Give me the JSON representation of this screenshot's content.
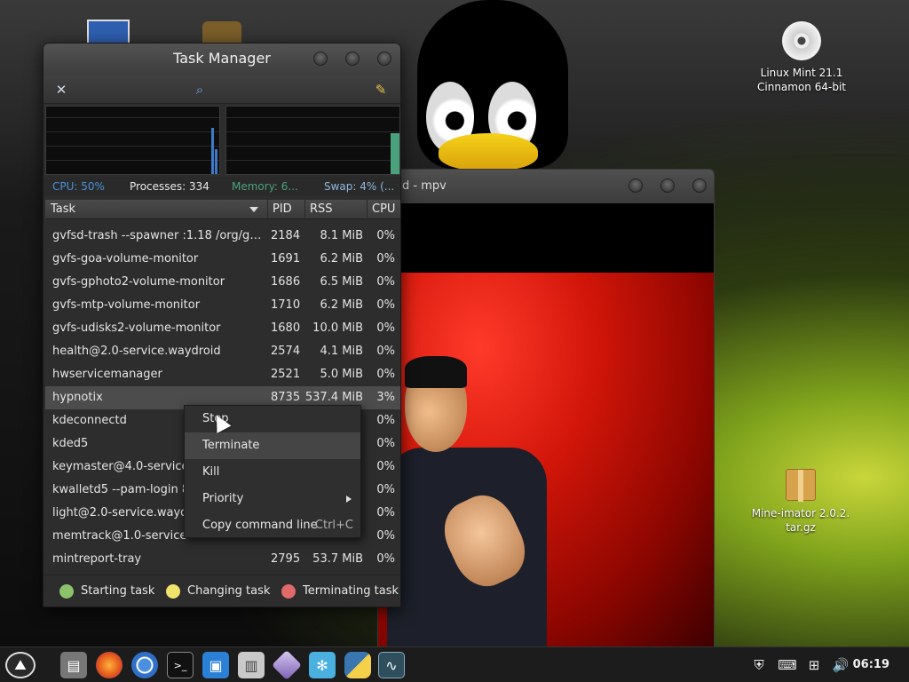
{
  "desktop": {
    "icons": [
      {
        "label_line1": "Linux Mint 21.1",
        "label_line2": "Cinnamon 64-bit"
      },
      {
        "label_line1": "Mine-imator 2.0.2.",
        "label_line2": "tar.gz"
      }
    ]
  },
  "mpv": {
    "title": "d - mpv"
  },
  "task_manager": {
    "title": "Task Manager",
    "status": {
      "cpu": "CPU: 50%",
      "processes": "Processes: 334",
      "memory": "Memory: 6...",
      "swap": "Swap: 4% (..."
    },
    "columns": {
      "task": "Task",
      "pid": "PID",
      "rss": "RSS",
      "cpu": "CPU"
    },
    "rows": [
      {
        "task": "gvfsd-trash --spawner :1.18 /org/gtk/...",
        "pid": "2184",
        "rss": "8.1 MiB",
        "cpu": "0%"
      },
      {
        "task": "gvfs-goa-volume-monitor",
        "pid": "1691",
        "rss": "6.2 MiB",
        "cpu": "0%"
      },
      {
        "task": "gvfs-gphoto2-volume-monitor",
        "pid": "1686",
        "rss": "6.5 MiB",
        "cpu": "0%"
      },
      {
        "task": "gvfs-mtp-volume-monitor",
        "pid": "1710",
        "rss": "6.2 MiB",
        "cpu": "0%"
      },
      {
        "task": "gvfs-udisks2-volume-monitor",
        "pid": "1680",
        "rss": "10.0 MiB",
        "cpu": "0%"
      },
      {
        "task": "health@2.0-service.waydroid",
        "pid": "2574",
        "rss": "4.1 MiB",
        "cpu": "0%"
      },
      {
        "task": "hwservicemanager",
        "pid": "2521",
        "rss": "5.0 MiB",
        "cpu": "0%"
      },
      {
        "task": "hypnotix",
        "pid": "8735",
        "rss": "537.4 MiB",
        "cpu": "3%"
      },
      {
        "task": "kdeconnectd",
        "pid": "",
        "rss": "",
        "cpu": "0%"
      },
      {
        "task": "kded5",
        "pid": "",
        "rss": "",
        "cpu": "0%"
      },
      {
        "task": "keymaster@4.0-service",
        "pid": "",
        "rss": "",
        "cpu": "0%"
      },
      {
        "task": "kwalletd5 --pam-login 8 9",
        "pid": "",
        "rss": "",
        "cpu": "0%"
      },
      {
        "task": "light@2.0-service.waydroid",
        "pid": "",
        "rss": "",
        "cpu": "0%"
      },
      {
        "task": "memtrack@1.0-service",
        "pid": "",
        "rss": "",
        "cpu": "0%"
      },
      {
        "task": "mintreport-tray",
        "pid": "2795",
        "rss": "53.7 MiB",
        "cpu": "0%"
      }
    ],
    "legend": {
      "starting": "Starting task",
      "changing": "Changing task",
      "terminating": "Terminating task"
    },
    "colors": {
      "starting": "#8bc36a",
      "changing": "#f0e36a",
      "terminating": "#e06a6a",
      "cpu": "#4a90d9",
      "memory": "#4aa27c"
    }
  },
  "context_menu": {
    "items": [
      {
        "label": "Stop",
        "shortcut": ""
      },
      {
        "label": "Terminate",
        "shortcut": ""
      },
      {
        "label": "Kill",
        "shortcut": ""
      },
      {
        "label": "Priority",
        "shortcut": ""
      },
      {
        "label": "Copy command line",
        "shortcut": "Ctrl+C"
      }
    ]
  },
  "taskbar": {
    "apps": [
      "menu-icon",
      "files-icon",
      "firefox-icon",
      "chromium-icon",
      "terminal-icon",
      "store-icon",
      "archive-icon",
      "mine-imator-icon",
      "waydroid-icon",
      "python-icon",
      "system-monitor-icon"
    ],
    "clock": "06:19"
  }
}
